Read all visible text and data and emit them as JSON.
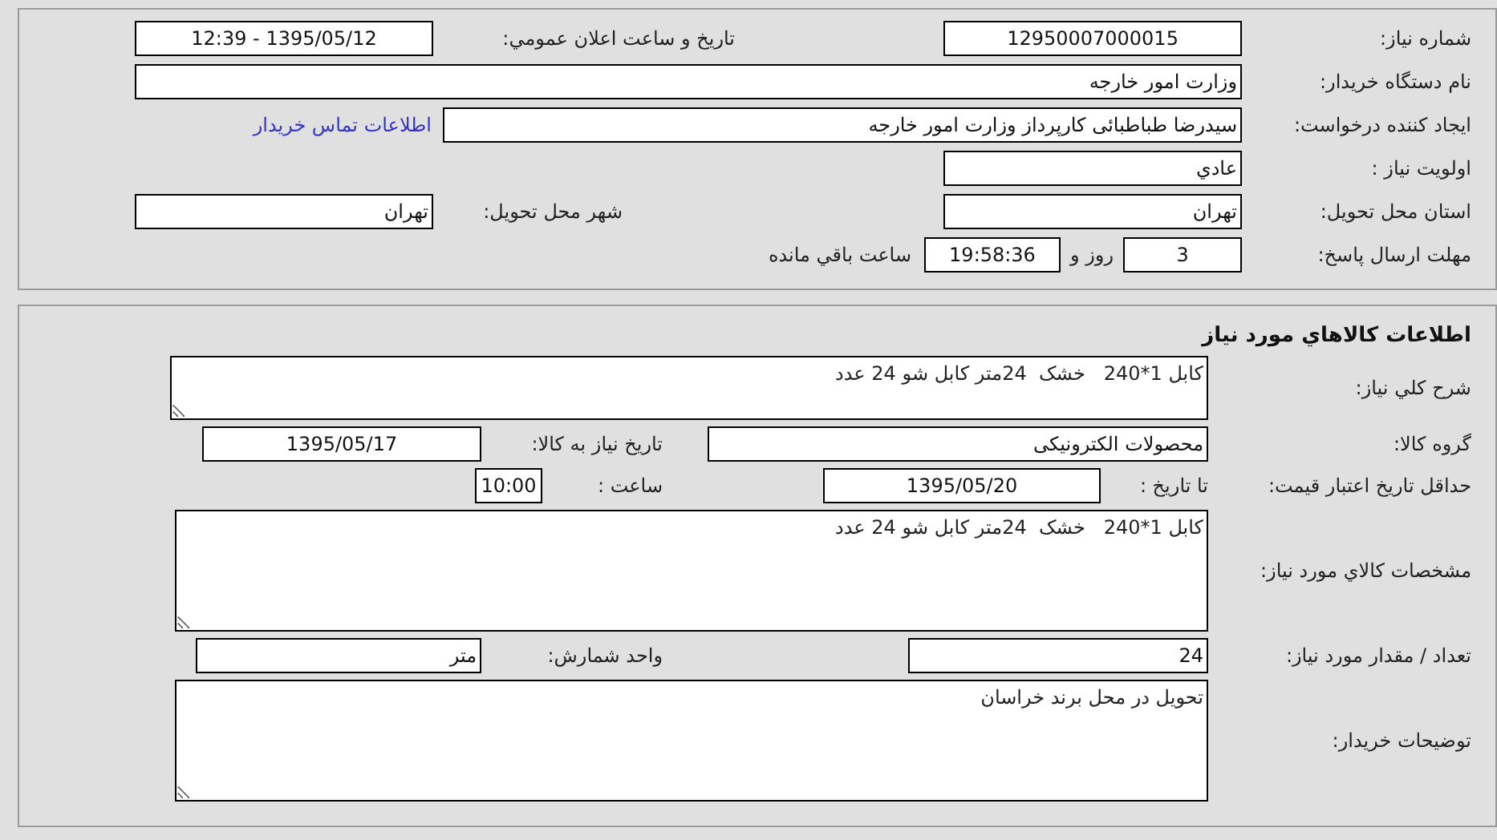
{
  "need_info": {
    "need_number": {
      "label": "شماره نیاز:",
      "value": "12950007000015"
    },
    "announce_datetime": {
      "label": "تاريخ و ساعت اعلان عمومي:",
      "value": "1395/05/12 - 12:39"
    },
    "buyer_org": {
      "label": "نام دستگاه خریدار:",
      "value": "وزارت امور خارجه"
    },
    "requester": {
      "label": "ایجاد کننده درخواست:",
      "value": "سیدرضا طباطبائی کارپرداز وزارت امور خارجه"
    },
    "buyer_contact_link": "اطلاعات تماس خریدار",
    "priority": {
      "label": "اولویت نیاز :",
      "value": "عادي"
    },
    "province": {
      "label": "استان محل تحویل:",
      "value": "تهران"
    },
    "city": {
      "label": "شهر محل تحویل:",
      "value": "تهران"
    },
    "deadline": {
      "label": "مهلت ارسال پاسخ:",
      "days": "3",
      "days_text": "روز و",
      "time": "19:58:36",
      "time_text": "ساعت باقي مانده"
    }
  },
  "goods_info": {
    "title": "اطلاعات کالاهاي مورد نياز",
    "general_description": {
      "label": "شرح کلي نياز:",
      "value": "کابل 1*240   خشک  24متر کابل شو 24 عدد"
    },
    "goods_group": {
      "label": "گروه کالا:",
      "value": "محصولات الکترونیکی"
    },
    "need_date": {
      "label": "تاریخ نیاز به کالا:",
      "value": "1395/05/17"
    },
    "price_validity": {
      "label": "حداقل تاریخ اعتبار قیمت:",
      "date_label": "تا تاریخ :",
      "date": "1395/05/20",
      "time_label": "ساعت :",
      "time": "10:00"
    },
    "specifications": {
      "label": "مشخصات کالاي مورد نياز:",
      "value": "کابل 1*240   خشک  24متر کابل شو 24 عدد"
    },
    "quantity": {
      "label": "تعداد / مقدار مورد نياز:",
      "value": "24"
    },
    "unit": {
      "label": "واحد شمارش:",
      "value": "متر"
    },
    "buyer_notes": {
      "label": "توضیحات خریدار:",
      "value": "تحویل در محل برند خراسان"
    }
  }
}
